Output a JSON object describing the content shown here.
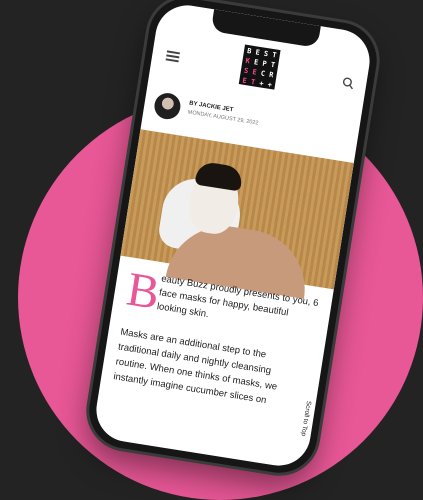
{
  "post": {
    "author_label": "BY JACKIE JET",
    "date": "MONDAY, AUGUST 29, 2022",
    "dropcap": "B",
    "intro": "eauty Buzz proudly presents to you, 6 face masks for happy, beautiful looking skin.",
    "body": "Masks are an additional step to the traditional daily and nightly cleansing routine. When one thinks of masks, we instantly imagine cucumber slices on"
  },
  "scroll_top_label": "Scroll to Top",
  "colors": {
    "background": "#232323",
    "accent_pink": "#e85796",
    "phone_frame": "#161616"
  },
  "icons": {
    "menu": "hamburger-menu-icon",
    "search": "search-icon"
  }
}
